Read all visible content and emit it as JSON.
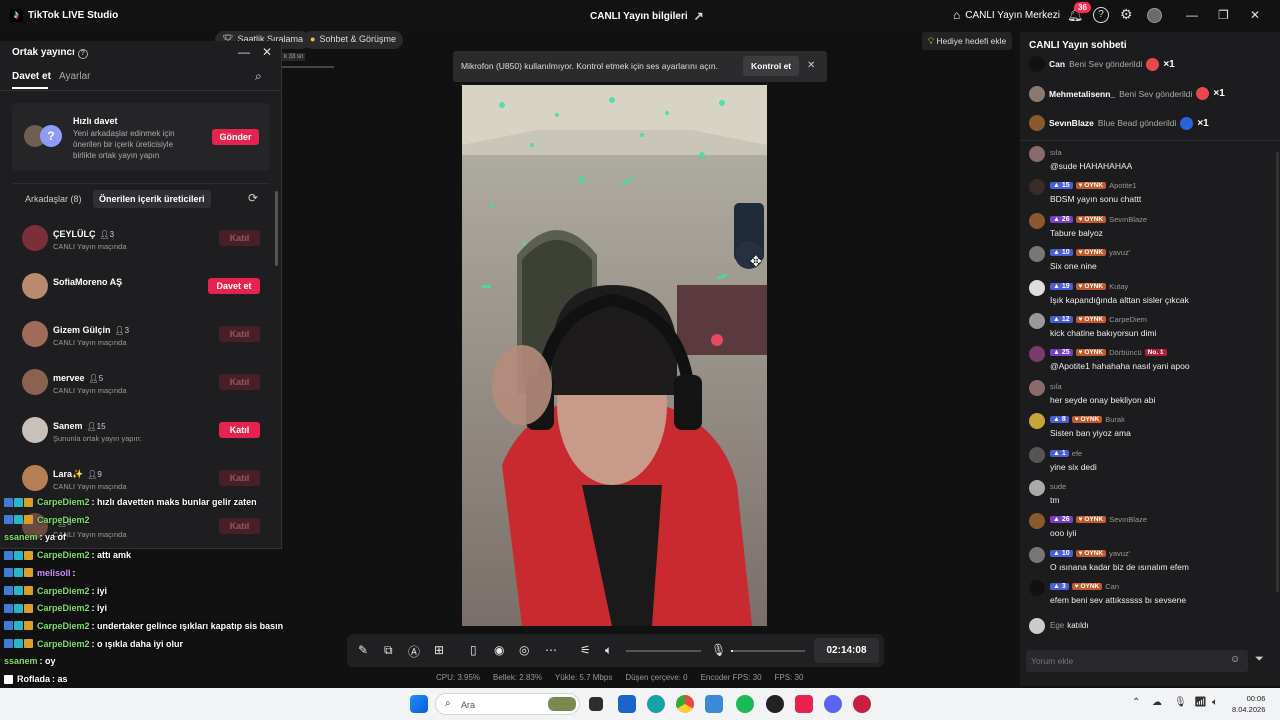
{
  "titlebar": {
    "app_name": "TikTok LIVE Studio",
    "center_title": "CANLI Yayın bilgileri",
    "live_center": "CANLI Yayın Merkezi",
    "notification_count": "36"
  },
  "toolbar": {
    "weekly_ranking": "Saatlik Sıralama",
    "chat_and_meet": "Sohbet & Görüşme",
    "gift_goal": "Hediye hedefi ekle"
  },
  "cohost_panel": {
    "title": "Ortak yayıncı",
    "tabs": [
      "Davet et",
      "Ayarlar"
    ],
    "quick_invite": {
      "title": "Hızlı davet",
      "description": "Yeni arkadaşlar edinmek için önerilen bir içerik üreticisiyle birlikte ortak yayın yapın",
      "button": "Gönder"
    },
    "friends_label": "Arkadaşlar (8)",
    "suggested_label": "Önerilen içerik üreticileri",
    "friends": [
      {
        "name": "ÇEYLÜLÇ",
        "count": "3",
        "status": "CANLI Yayın maçında",
        "button": "Katıl",
        "active": false,
        "color": "#7a2f3a"
      },
      {
        "name": "SofiaMoreno AŞ",
        "count": "",
        "status": "",
        "button": "Davet et",
        "active": true,
        "color": "#b88a70"
      },
      {
        "name": "Gizem Gülçin",
        "count": "3",
        "status": "CANLI Yayın maçında",
        "button": "Katıl",
        "active": false,
        "color": "#a06b58"
      },
      {
        "name": "mervee",
        "count": "5",
        "status": "CANLI Yayın maçında",
        "button": "Katıl",
        "active": false,
        "color": "#8a6350"
      },
      {
        "name": "Sanem",
        "count": "15",
        "status": "Şununla ortak yayın yapın:",
        "button": "Katıl",
        "active": true,
        "color": "#c8c0bb"
      },
      {
        "name": "Lara✨",
        "count": "9",
        "status": "CANLI Yayın maçında",
        "button": "Katıl",
        "active": false,
        "color": "#b57e55"
      },
      {
        "name": "",
        "count": "6",
        "status": "CANLI Yayın maçında",
        "button": "Katıl",
        "active": false,
        "color": "#6b4a40"
      }
    ]
  },
  "overlay_chat": [
    {
      "user": "CarpeDiem2",
      "text": ": hızlı davetten maks bunlar gelir zaten",
      "badges": true,
      "color": "g"
    },
    {
      "user": "CarpeDiem2",
      "text": "",
      "badges": true,
      "color": "g"
    },
    {
      "user": "ssanem",
      "text": ": ya of",
      "badges": false,
      "color": "g"
    },
    {
      "user": "CarpeDiem2",
      "text": ": attı amk",
      "badges": true,
      "color": "g"
    },
    {
      "user": "melisoll",
      "text": ":",
      "badges": true,
      "color": "p"
    },
    {
      "user": "CarpeDiem2",
      "text": ": iyi",
      "badges": true,
      "color": "g"
    },
    {
      "user": "CarpeDiem2",
      "text": ": iyi",
      "badges": true,
      "color": "g"
    },
    {
      "user": "CarpeDiem2",
      "text": ": undertaker gelince ışıkları kapatıp sis basın",
      "badges": true,
      "color": "g"
    },
    {
      "user": "CarpeDiem2",
      "text": ": o ışıkla daha iyi olur",
      "badges": true,
      "color": "g"
    },
    {
      "user": "ssanem",
      "text": ": oy",
      "badges": false,
      "color": "g"
    },
    {
      "user": "Roflada",
      "text": ": as",
      "badges": false,
      "color": "w"
    }
  ],
  "notification": {
    "text": "Mikrofon (U850) kullanılmıyor. Kontrol etmek için ses ayarlarını açın.",
    "button": "Kontrol et"
  },
  "controls": {
    "timer": "02:14:08",
    "volume_level": 0.0,
    "mic_level": 0.03
  },
  "stats": {
    "cpu": "CPU: 3.95%",
    "memory": "Bellek: 2.83%",
    "upload": "Yükle: 5.7 Mbps",
    "dropped": "Düşen çerçeve: 0",
    "encoder_fps": "Encoder FPS: 30",
    "fps": "FPS: 30"
  },
  "live_chat": {
    "title": "CANLI Yayın sohbeti",
    "gifts": [
      {
        "user": "Can",
        "gift": "Beni Sev gönderildi",
        "count": "×1",
        "icon_color": "#e8474f",
        "avatar": "#111"
      },
      {
        "user": "Mehmetalisenn_",
        "gift": "Beni Sev gönderildi",
        "count": "×1",
        "icon_color": "#e8474f",
        "avatar": "#8a7a6e"
      },
      {
        "user": "SevınBlaze",
        "gift": "Blue Bead gönderildi",
        "count": "×1",
        "icon_color": "#2a63d8",
        "avatar": "#8a5a2e"
      }
    ],
    "messages": [
      {
        "user": "sıla",
        "level": "",
        "oynk": false,
        "text": "@sude HAHAHAHAA",
        "avatar": "#8a6a6a"
      },
      {
        "user": "Apotite1",
        "level": "15",
        "oynk": true,
        "text": "BDSM yayın sonu chattt",
        "avatar": "#3a2a2a"
      },
      {
        "user": "SevınBlaze",
        "level": "26",
        "oynk": true,
        "text": "Tabure balyoz",
        "avatar": "#8a5a2e",
        "purple": true
      },
      {
        "user": "yavuz'",
        "level": "10",
        "oynk": true,
        "text": "Six one nine",
        "avatar": "#777"
      },
      {
        "user": "Kutay",
        "level": "19",
        "oynk": true,
        "text": "Işık kapandığında alttan sisler çıkcak",
        "avatar": "#ddd"
      },
      {
        "user": "CarpeDiem",
        "level": "12",
        "oynk": true,
        "text": "kick chatine bakıyorsun dimi",
        "avatar": "#999"
      },
      {
        "user": "Dörbüncü",
        "level": "25",
        "oynk": true,
        "text": "@Apotite1 hahahaha nasıl yani apoo",
        "avatar": "#7a3a6a",
        "purple": true,
        "no1": "No. 1"
      },
      {
        "user": "sıla",
        "level": "",
        "oynk": false,
        "text": "her seyde onay bekliyon abi",
        "avatar": "#8a6a6a"
      },
      {
        "user": "Burak",
        "level": "8",
        "oynk": true,
        "text": "Sisten ban yiyoz ama",
        "avatar": "#c9a43a"
      },
      {
        "user": "efe",
        "level": "1",
        "oynk": false,
        "text": "yine six dedi",
        "avatar": "#555"
      },
      {
        "user": "sude",
        "level": "",
        "oynk": false,
        "text": "tm",
        "avatar": "#aaa"
      },
      {
        "user": "SevınBlaze",
        "level": "26",
        "oynk": true,
        "text": "ooo iyii",
        "avatar": "#8a5a2e",
        "purple": true
      },
      {
        "user": "yavuz'",
        "level": "10",
        "oynk": true,
        "text": "O ısınana kadar biz de ısınalım efem",
        "avatar": "#777"
      },
      {
        "user": "Can",
        "level": "3",
        "oynk": true,
        "text": "efem beni sev attıksssss bı sevsene",
        "avatar": "#111"
      }
    ],
    "join": {
      "user": "Ege",
      "text": "katıldı"
    },
    "input_placeholder": "Yorum ekle"
  },
  "taskbar": {
    "search": "Ara",
    "time": "00:06",
    "date": "8.04.2026"
  }
}
